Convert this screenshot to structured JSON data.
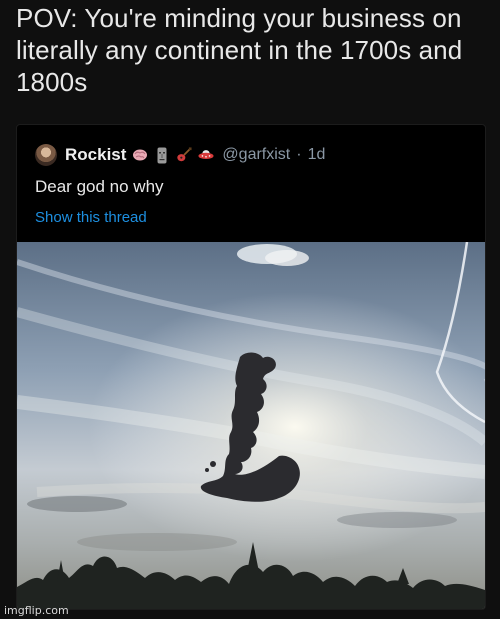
{
  "caption": {
    "text": "POV: You're minding your business on literally any continent in the 1700s and 1800s"
  },
  "tweet": {
    "display_name": "Rockist",
    "emojis": [
      "brain-emoji",
      "moai-emoji",
      "guitar-emoji",
      "flying-saucer-emoji"
    ],
    "handle": "@garfxist",
    "separator": "·",
    "time": "1d",
    "text": "Dear god no why",
    "show_thread_label": "Show this thread"
  },
  "photo": {
    "subject": "great-britain-shaped-cloud-photo"
  },
  "watermark": {
    "text": "imgflip.com"
  }
}
